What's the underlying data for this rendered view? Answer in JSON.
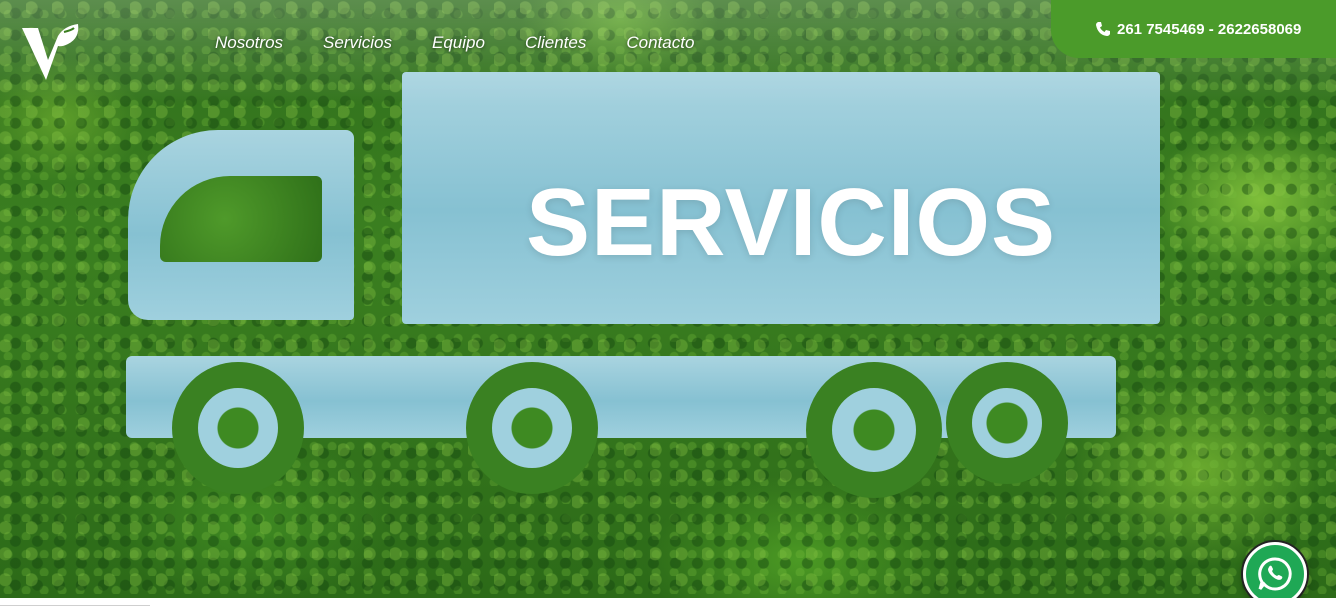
{
  "brand": {
    "logo": "leaf-v-logo"
  },
  "nav": {
    "items": [
      {
        "label": "Nosotros"
      },
      {
        "label": "Servicios"
      },
      {
        "label": "Equipo"
      },
      {
        "label": "Clientes"
      },
      {
        "label": "Contacto"
      }
    ]
  },
  "contact": {
    "phone_text": "261 7545469 - 2622658069",
    "icon": "phone-icon",
    "color": "#4b9b2a"
  },
  "hero": {
    "title": "SERVICIOS",
    "background": "aerial-forest-truck-lake-image"
  },
  "whatsapp": {
    "icon": "whatsapp-icon",
    "color": "#1fa855"
  }
}
